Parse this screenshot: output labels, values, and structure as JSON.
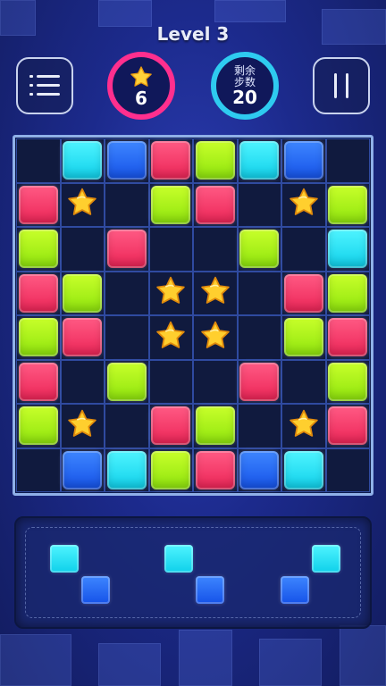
{
  "header": {
    "title": "Level 3",
    "star_count": "6",
    "steps_label_line1": "剩余",
    "steps_label_line2": "步数",
    "steps_count": "20"
  },
  "colors": {
    "cyan": "#1fdcf0",
    "blue": "#2a6cf5",
    "red": "#f23a68",
    "lime": "#a8f01a",
    "star_ring": "#ff2f8e",
    "steps_ring": "#2ecbf0"
  },
  "board": {
    "rows": 8,
    "cols": 8,
    "grid": [
      [
        "",
        "cyan",
        "blue",
        "red",
        "lime",
        "cyan",
        "blue",
        ""
      ],
      [
        "red",
        "star",
        "",
        "lime",
        "red",
        "",
        "star",
        "lime"
      ],
      [
        "lime",
        "",
        "red",
        "",
        "",
        "lime",
        "",
        "cyan"
      ],
      [
        "red",
        "lime",
        "",
        "star",
        "star",
        "",
        "red",
        "lime"
      ],
      [
        "lime",
        "red",
        "",
        "star",
        "star",
        "",
        "lime",
        "red"
      ],
      [
        "red",
        "",
        "lime",
        "",
        "",
        "red",
        "",
        "lime"
      ],
      [
        "lime",
        "star",
        "",
        "red",
        "lime",
        "",
        "star",
        "red"
      ],
      [
        "",
        "blue",
        "cyan",
        "lime",
        "red",
        "blue",
        "cyan",
        ""
      ]
    ]
  },
  "pieces": [
    {
      "name": "piece-1",
      "cells": [
        [
          "cyan",
          0,
          0
        ],
        [
          "blue",
          1,
          1
        ]
      ]
    },
    {
      "name": "piece-2",
      "cells": [
        [
          "cyan",
          0,
          0
        ],
        [
          "blue",
          1,
          1
        ]
      ]
    },
    {
      "name": "piece-3",
      "cells": [
        [
          "cyan",
          0,
          1
        ],
        [
          "blue",
          1,
          0
        ]
      ]
    }
  ],
  "icons": [
    "menu-icon",
    "pause-icon",
    "star-icon"
  ]
}
